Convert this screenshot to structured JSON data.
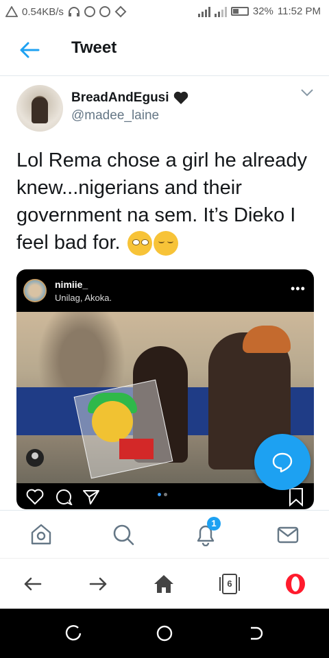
{
  "status_bar": {
    "network_speed": "0.54KB/s",
    "battery_percent": "32%",
    "time": "11:52 PM"
  },
  "header": {
    "title": "Tweet"
  },
  "tweet": {
    "display_name": "BreadAndEgusi",
    "handle": "@madee_laine",
    "text": "Lol Rema chose a girl he already knew...nigerians and their government na sem. It’s Dieko I feel bad for.",
    "emojis": [
      "face-with-rolling-eyes",
      "pensive-face"
    ]
  },
  "media": {
    "ig_username": "nimiie_",
    "ig_location": "Unilag, Akoka.",
    "more_label": "•••",
    "carousel_pages": 2,
    "carousel_current": 1
  },
  "tab_bar": {
    "notifications_badge": "1"
  },
  "browser_bar": {
    "tab_count": "6"
  },
  "colors": {
    "accent": "#1da1f2",
    "text": "#14171a",
    "secondary_text": "#657786",
    "opera_red": "#ff1b2d"
  }
}
